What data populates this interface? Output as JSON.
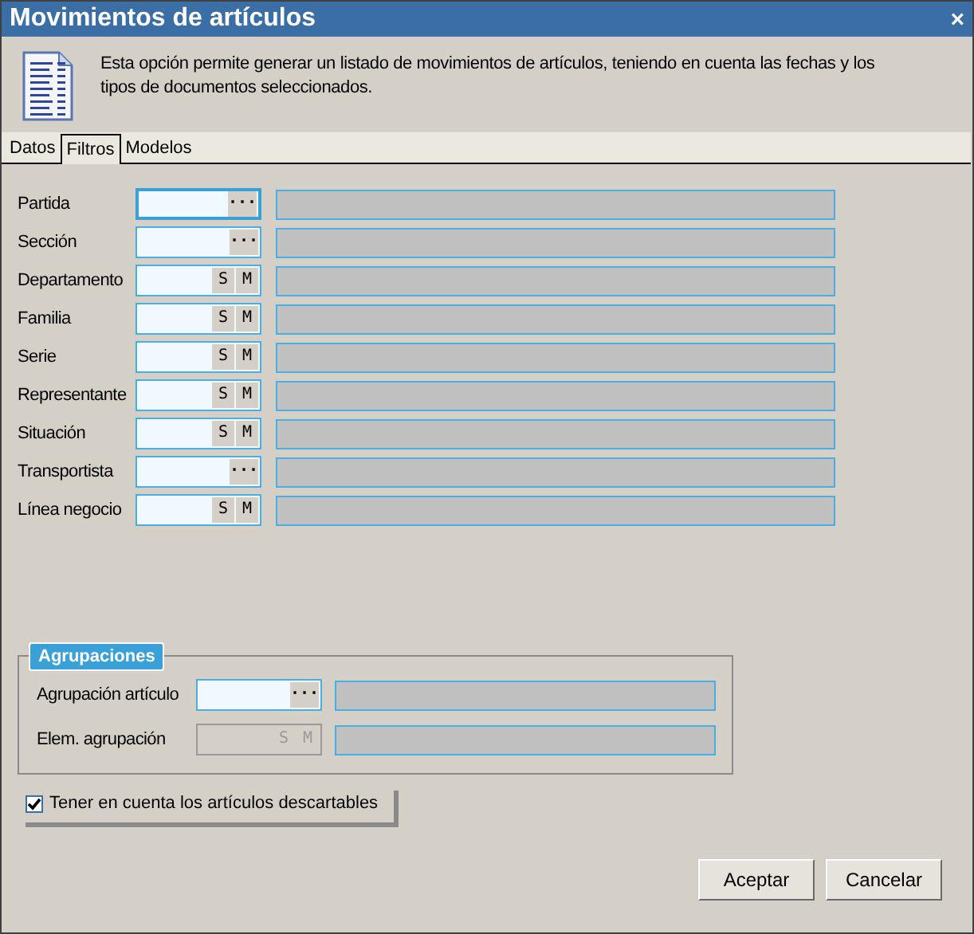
{
  "window": {
    "title": "Movimientos de artículos",
    "close": "×"
  },
  "description": "Esta opción permite generar un listado de movimientos de artículos, teniendo en cuenta las fechas y los tipos de documentos seleccionados.",
  "tabs": [
    {
      "label": "Datos",
      "selected": false
    },
    {
      "label": "Filtros",
      "selected": true
    },
    {
      "label": "Modelos",
      "selected": false
    }
  ],
  "filters": [
    {
      "label": "Partida",
      "kind": "lookup",
      "buttons": [
        "···"
      ],
      "focused": true,
      "disabled": false
    },
    {
      "label": "Sección",
      "kind": "lookup",
      "buttons": [
        "···"
      ],
      "focused": false,
      "disabled": false
    },
    {
      "label": "Departamento",
      "kind": "sm",
      "buttons": [
        "S",
        "M"
      ],
      "focused": false,
      "disabled": false
    },
    {
      "label": "Familia",
      "kind": "sm",
      "buttons": [
        "S",
        "M"
      ],
      "focused": false,
      "disabled": false
    },
    {
      "label": "Serie",
      "kind": "sm",
      "buttons": [
        "S",
        "M"
      ],
      "focused": false,
      "disabled": false
    },
    {
      "label": "Representante",
      "kind": "sm",
      "buttons": [
        "S",
        "M"
      ],
      "focused": false,
      "disabled": false
    },
    {
      "label": "Situación",
      "kind": "sm",
      "buttons": [
        "S",
        "M"
      ],
      "focused": false,
      "disabled": false
    },
    {
      "label": "Transportista",
      "kind": "lookup",
      "buttons": [
        "···"
      ],
      "focused": false,
      "disabled": false
    },
    {
      "label": "Línea negocio",
      "kind": "sm",
      "buttons": [
        "S",
        "M"
      ],
      "focused": false,
      "disabled": false
    }
  ],
  "groupings": {
    "title": "Agrupaciones",
    "fields": [
      {
        "label": "Agrupación artículo",
        "kind": "lookup",
        "buttons": [
          "···"
        ],
        "focused": false,
        "disabled": false
      },
      {
        "label": "Elem. agrupación",
        "kind": "sm",
        "buttons": [
          "S",
          "M"
        ],
        "focused": false,
        "disabled": true
      }
    ]
  },
  "checkbox": {
    "label": "Tener en cuenta los artículos descartables",
    "checked": true
  },
  "buttons": [
    "Aceptar",
    "Cancelar"
  ]
}
